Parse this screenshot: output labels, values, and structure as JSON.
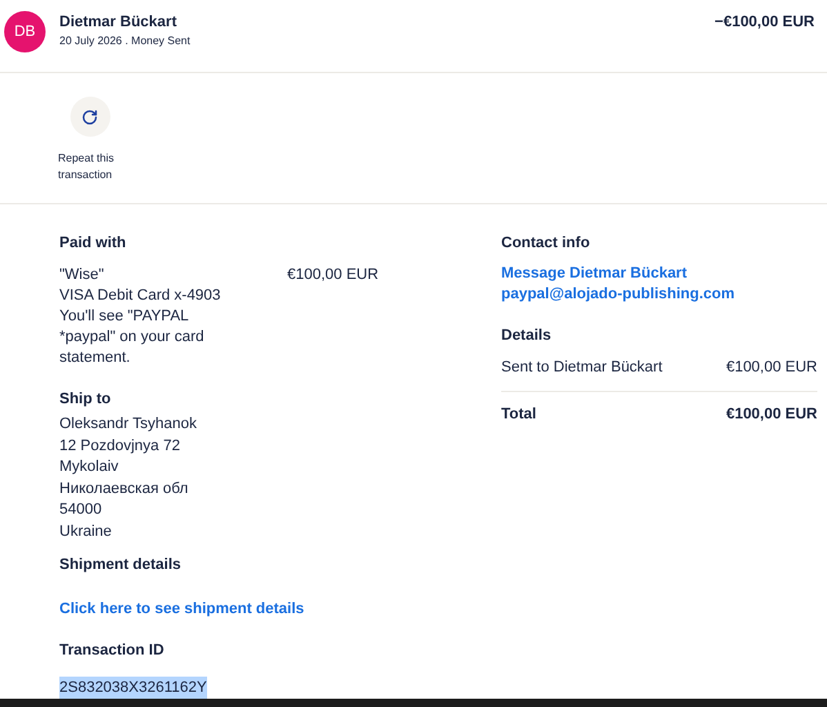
{
  "header": {
    "initials": "DB",
    "name": "Dietmar Bückart",
    "subtitle": "20 July 2026 . Money Sent",
    "amount": "−€100,00 EUR"
  },
  "actions": [
    {
      "label": "Repeat this transaction"
    }
  ],
  "paid_with": {
    "title": "Paid with",
    "lines": [
      "\"Wise\"",
      "VISA Debit Card x-4903",
      "You'll see \"PAYPAL *paypal\" on your card statement."
    ],
    "amount": "€100,00 EUR"
  },
  "ship_to": {
    "title": "Ship to",
    "lines": [
      "Oleksandr Tsyhanok",
      "12 Pozdovjnya 72",
      "Mykolaiv",
      "Николаевская обл",
      "54000",
      "Ukraine"
    ]
  },
  "shipment_details": {
    "title": "Shipment details",
    "link": "Click here to see shipment details"
  },
  "transaction_id": {
    "title": "Transaction ID",
    "value": "2S832038X3261162Y",
    "highlighted": true
  },
  "contact_info": {
    "title": "Contact info",
    "links": [
      "Message Dietmar Bückart",
      "paypal@alojado-publishing.com"
    ]
  },
  "details": {
    "title": "Details",
    "rows": [
      {
        "label": "Sent to Dietmar Bückart",
        "value": "€100,00 EUR"
      }
    ],
    "total": {
      "label": "Total",
      "value": "€100,00 EUR"
    }
  }
}
